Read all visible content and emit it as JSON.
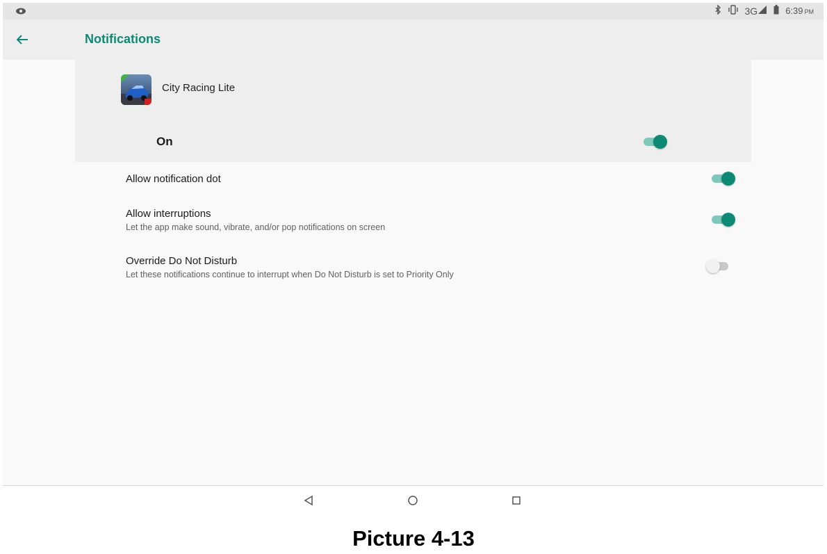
{
  "status_bar": {
    "left_icon": "eye-icon",
    "icons": [
      "bluetooth-icon",
      "vibrate-icon",
      "signal-icon",
      "battery-icon"
    ],
    "network": "3G",
    "time": "6:39",
    "ampm": "PM"
  },
  "app_bar": {
    "back_icon": "back-arrow-icon",
    "title": "Notifications"
  },
  "app": {
    "name": "City Racing Lite",
    "icon": "app-icon",
    "master_toggle": {
      "label": "On",
      "state": true
    }
  },
  "settings": [
    {
      "title": "Allow notification dot",
      "subtitle": "",
      "state": true
    },
    {
      "title": "Allow interruptions",
      "subtitle": "Let the app make sound, vibrate, and/or pop notifications on screen",
      "state": true
    },
    {
      "title": "Override Do Not Disturb",
      "subtitle": "Let these notifications continue to interrupt when Do Not Disturb is set to Priority Only",
      "state": false
    }
  ],
  "nav_bar": {
    "buttons": [
      "back-triangle-icon",
      "home-circle-icon",
      "recents-square-icon"
    ]
  },
  "caption": "Picture 4-13",
  "colors": {
    "accent": "#0c8a76",
    "accent_track": "#7fc8bc",
    "status_bar_bg": "#e6e6e6",
    "app_bar_bg": "#eeeeee",
    "page_bg": "#f9f9f9"
  }
}
